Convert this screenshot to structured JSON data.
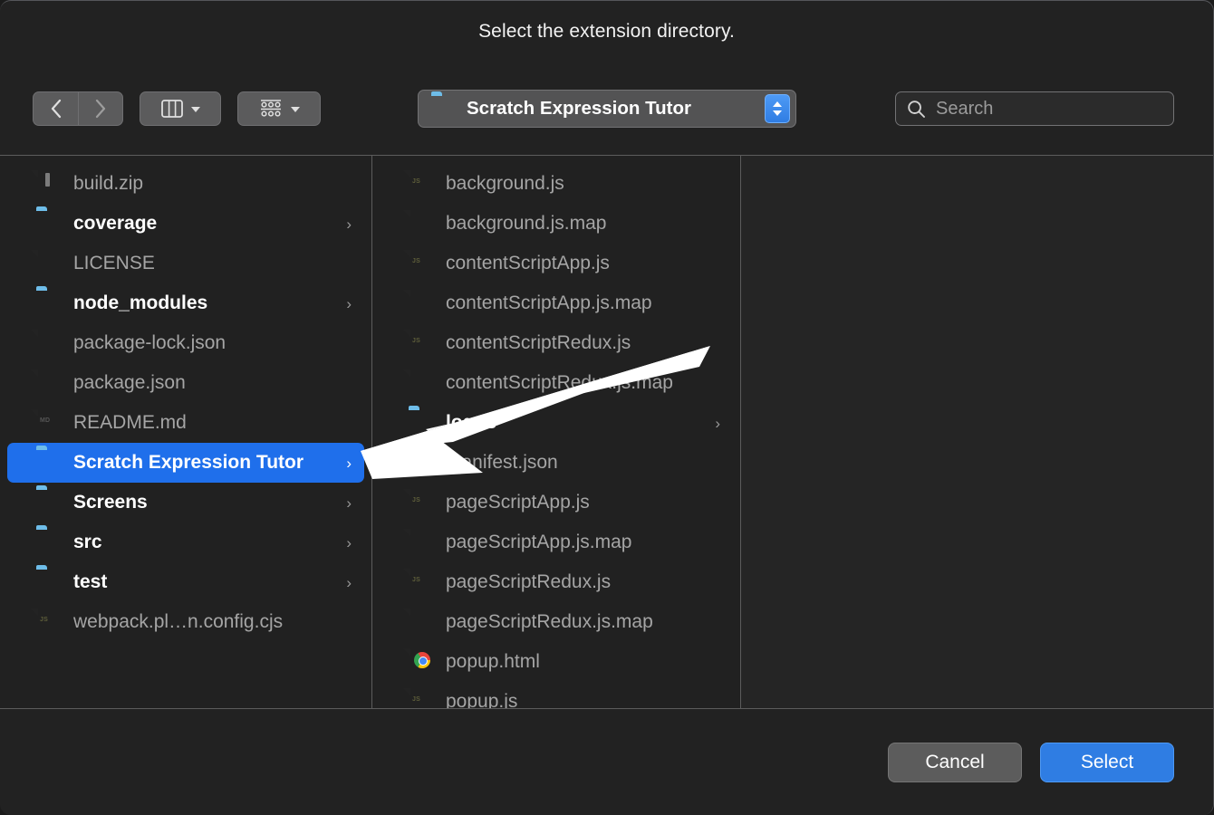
{
  "dialog": {
    "title": "Select the extension directory."
  },
  "toolbar": {
    "back_button": "Back",
    "forward_button": "Forward",
    "view_mode_button": "Column View",
    "arrange_button": "Group Items",
    "path": {
      "label": "Scratch Expression Tutor",
      "icon": "folder-icon",
      "stepper": "up-down-stepper"
    },
    "search": {
      "placeholder": "Search",
      "icon": "search-icon"
    }
  },
  "columns": [
    {
      "name": "column-1",
      "items": [
        {
          "label": "build.zip",
          "kind": "file",
          "icon": "zip-file-icon",
          "selected": false,
          "disclosure": false
        },
        {
          "label": "coverage",
          "kind": "folder",
          "icon": "folder-icon",
          "selected": false,
          "disclosure": true
        },
        {
          "label": "LICENSE",
          "kind": "file",
          "icon": "plain-file-icon",
          "selected": false,
          "disclosure": false
        },
        {
          "label": "node_modules",
          "kind": "folder",
          "icon": "folder-icon",
          "selected": false,
          "disclosure": true
        },
        {
          "label": "package-lock.json",
          "kind": "file",
          "icon": "text-file-icon",
          "selected": false,
          "disclosure": false
        },
        {
          "label": "package.json",
          "kind": "file",
          "icon": "text-file-icon",
          "selected": false,
          "disclosure": false
        },
        {
          "label": "README.md",
          "kind": "file",
          "icon": "markdown-file-icon",
          "selected": false,
          "disclosure": false
        },
        {
          "label": "Scratch Expression Tutor",
          "kind": "folder",
          "icon": "folder-icon",
          "selected": true,
          "disclosure": true
        },
        {
          "label": "Screens",
          "kind": "folder",
          "icon": "folder-icon",
          "selected": false,
          "disclosure": true
        },
        {
          "label": "src",
          "kind": "folder",
          "icon": "folder-icon",
          "selected": false,
          "disclosure": true
        },
        {
          "label": "test",
          "kind": "folder",
          "icon": "folder-icon",
          "selected": false,
          "disclosure": true
        },
        {
          "label": "webpack.pl…n.config.cjs",
          "kind": "file",
          "icon": "js-file-icon",
          "selected": false,
          "disclosure": false
        }
      ]
    },
    {
      "name": "column-2",
      "items": [
        {
          "label": "background.js",
          "kind": "file",
          "icon": "js-file-icon",
          "selected": false,
          "disclosure": false
        },
        {
          "label": "background.js.map",
          "kind": "file",
          "icon": "plain-file-icon",
          "selected": false,
          "disclosure": false
        },
        {
          "label": "contentScriptApp.js",
          "kind": "file",
          "icon": "js-file-icon",
          "selected": false,
          "disclosure": false
        },
        {
          "label": "contentScriptApp.js.map",
          "kind": "file",
          "icon": "plain-file-icon",
          "selected": false,
          "disclosure": false
        },
        {
          "label": "contentScriptRedux.js",
          "kind": "file",
          "icon": "js-file-icon",
          "selected": false,
          "disclosure": false
        },
        {
          "label": "contentScriptRedux.js.map",
          "kind": "file",
          "icon": "plain-file-icon",
          "selected": false,
          "disclosure": false
        },
        {
          "label": "logos",
          "kind": "folder",
          "icon": "folder-icon",
          "selected": false,
          "disclosure": true
        },
        {
          "label": "manifest.json",
          "kind": "file",
          "icon": "text-file-icon",
          "selected": false,
          "disclosure": false
        },
        {
          "label": "pageScriptApp.js",
          "kind": "file",
          "icon": "js-file-icon",
          "selected": false,
          "disclosure": false
        },
        {
          "label": "pageScriptApp.js.map",
          "kind": "file",
          "icon": "plain-file-icon",
          "selected": false,
          "disclosure": false
        },
        {
          "label": "pageScriptRedux.js",
          "kind": "file",
          "icon": "js-file-icon",
          "selected": false,
          "disclosure": false
        },
        {
          "label": "pageScriptRedux.js.map",
          "kind": "file",
          "icon": "plain-file-icon",
          "selected": false,
          "disclosure": false
        },
        {
          "label": "popup.html",
          "kind": "file",
          "icon": "chrome-file-icon",
          "selected": false,
          "disclosure": false
        },
        {
          "label": "popup.js",
          "kind": "file",
          "icon": "js-file-icon",
          "selected": false,
          "disclosure": false
        }
      ]
    },
    {
      "name": "column-3",
      "items": []
    }
  ],
  "footer": {
    "cancel_label": "Cancel",
    "select_label": "Select"
  },
  "colors": {
    "accent": "#2f7de3",
    "selection": "#1f6feb",
    "folder": "#4fa9e8",
    "background": "#222222",
    "divider": "#5c5c5c"
  },
  "cursor": {
    "icon": "arrow-pointer-icon"
  }
}
